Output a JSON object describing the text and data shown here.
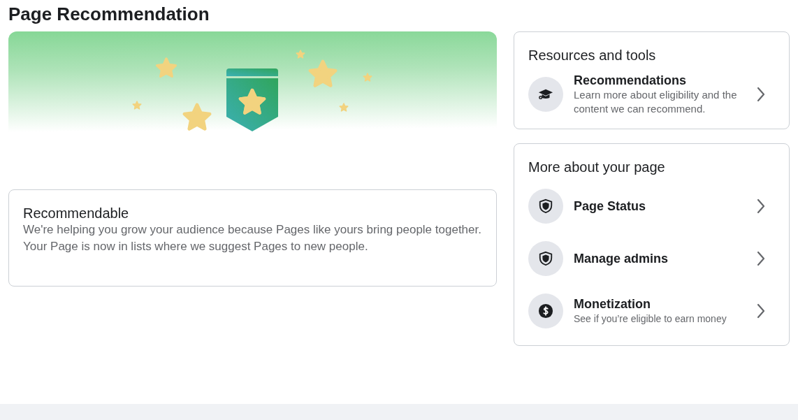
{
  "title": "Page Recommendation",
  "status_card": {
    "title": "Recommendable",
    "text": "We're helping you grow your audience because Pages like yours bring people together. Your Page is now in lists where we suggest Pages to new people."
  },
  "sections": [
    {
      "title": "Resources and tools",
      "items": [
        {
          "kind": "graduation",
          "title": "Recommendations",
          "subtitle": "Learn more about eligibility and the content we can recommend."
        }
      ]
    },
    {
      "title": "More about your page",
      "items": [
        {
          "kind": "shield",
          "title": "Page Status"
        },
        {
          "kind": "shield",
          "title": "Manage admins"
        },
        {
          "kind": "dollar",
          "title": "Monetization",
          "subtitle": "See if you’re eligible to earn money"
        }
      ]
    }
  ]
}
